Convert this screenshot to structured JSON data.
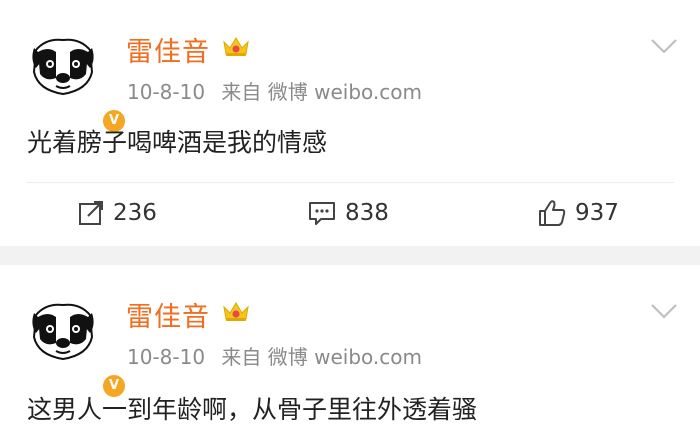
{
  "posts": [
    {
      "username": "雷佳音",
      "date": "10-8-10",
      "source": "来自 微博 weibo.com",
      "text": "光着膀子喝啤酒是我的情感",
      "reposts": "236",
      "comments": "838",
      "likes": "937"
    },
    {
      "username": "雷佳音",
      "date": "10-8-10",
      "source": "来自 微博 weibo.com",
      "text": "这男人一到年龄啊，从骨子里往外透着骚"
    }
  ],
  "icons": {
    "avatar": "dog-avatar-icon",
    "verified": "verified-badge-icon",
    "vip": "crown-icon",
    "menu": "chevron-down-icon",
    "repost": "repost-icon",
    "comment": "comment-icon",
    "like": "thumbs-up-icon"
  },
  "colors": {
    "username": "#f26d1f",
    "meta": "#8a8a8a",
    "badge": "#f5a623",
    "separator": "#f2f2f2"
  }
}
